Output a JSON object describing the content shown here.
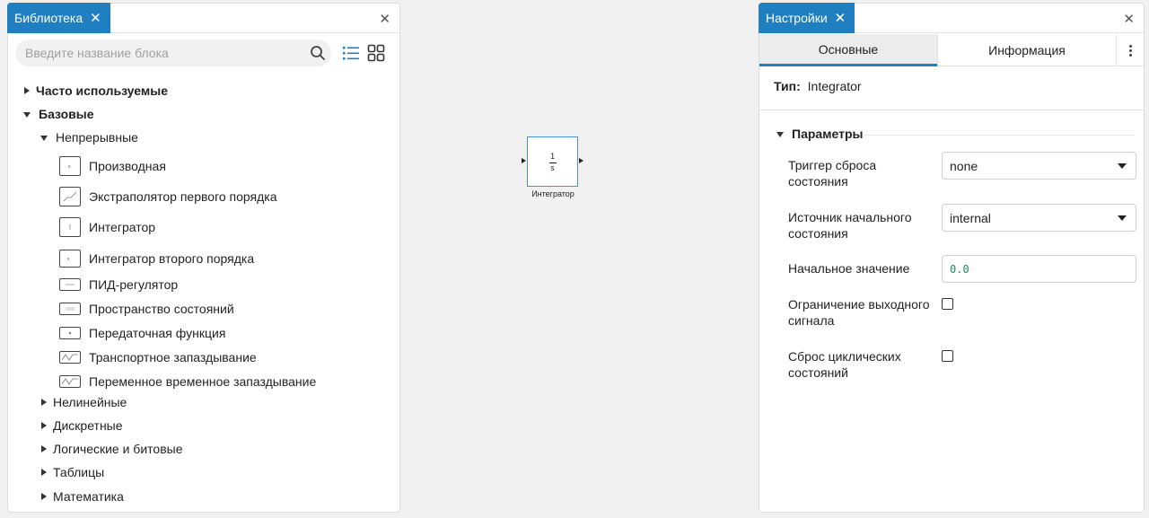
{
  "library": {
    "tab_label": "Библиотека",
    "tab_close": "✕",
    "panel_close": "✕",
    "search_placeholder": "Введите название блока",
    "tree": {
      "frequent": "Часто используемые",
      "basic": "Базовые",
      "continuous": "Непрерывные",
      "blocks": [
        "Производная",
        "Экстраполятор первого порядка",
        "Интегратор",
        "Интегратор второго порядка",
        "ПИД-регулятор",
        "Пространство состояний",
        "Передаточная функция",
        "Транспортное запаздывание",
        "Переменное временное запаздывание"
      ],
      "nonlinear": "Нелинейные",
      "discrete": "Дискретные",
      "logic": "Логические и битовые",
      "tables": "Таблицы",
      "math": "Математика"
    }
  },
  "canvas": {
    "block_num": "1",
    "block_den": "s",
    "block_caption": "Интегратор"
  },
  "settings": {
    "tab_label": "Настройки",
    "tab_close": "✕",
    "panel_close": "✕",
    "tabs": {
      "main": "Основные",
      "info": "Информация"
    },
    "type_label": "Тип:",
    "type_value": "Integrator",
    "section": "Параметры",
    "params": {
      "reset_trigger_label": "Триггер сброса состояния",
      "reset_trigger_value": "none",
      "init_source_label": "Источник начального состояния",
      "init_source_value": "internal",
      "init_value_label": "Начальное значение",
      "init_value": "0.0",
      "limit_label": "Ограничение выходного сигнала",
      "cyclic_label": "Сброс циклических состояний"
    }
  },
  "colors": {
    "accent": "#1f7fc1",
    "selection": "#4a90d9",
    "value_green": "#1a8a5a"
  }
}
